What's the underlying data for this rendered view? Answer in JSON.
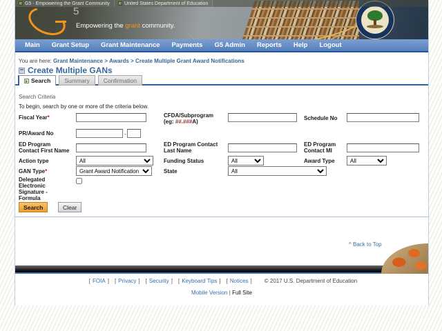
{
  "window": {
    "title_left": "G5 - Empowering the Grant Community",
    "title_right": "United States Department of Education"
  },
  "banner": {
    "logo_number": "5",
    "slogan_prefix": "Empowering the ",
    "slogan_accent": "grant",
    "slogan_suffix": " community."
  },
  "nav": {
    "items": [
      "Main",
      "Grant Setup",
      "Grant Maintenance",
      "Payments",
      "G5 Admin",
      "Reports",
      "Help",
      "Logout"
    ]
  },
  "breadcrumb": {
    "prefix": "You are here:",
    "separator": ">",
    "items": [
      "Grant Maintenance",
      "Awards",
      "Create Multiple Grant Award Notifications"
    ]
  },
  "page": {
    "title": "Create Multiple GANs"
  },
  "tabs": {
    "search": "Search",
    "summary": "Summary",
    "confirmation": "Confirmation"
  },
  "search_section": {
    "title": "Search Criteria",
    "instruction": "To begin, search by one or more of the criteria below."
  },
  "form": {
    "fiscal_year": {
      "label": "Fiscal Year",
      "required": "*"
    },
    "cfda": {
      "label": "CFDA/Subprogram",
      "hint_prefix": "(eg: ",
      "hint_pattern": "##.###",
      "hint_suffix": "A)"
    },
    "schedule_no": {
      "label": "Schedule No"
    },
    "pr_award": {
      "label": "PR/Award No",
      "separator": "-"
    },
    "ed_first": {
      "label": "ED Program Contact First Name"
    },
    "ed_last": {
      "label": "ED Program Contact Last Name"
    },
    "ed_mi": {
      "label": "ED Program Contact MI"
    },
    "action_type": {
      "label": "Action type",
      "value": "All"
    },
    "funding_status": {
      "label": "Funding Status",
      "value": "All"
    },
    "award_type": {
      "label": "Award Type",
      "value": "All"
    },
    "gan_type": {
      "label": "GAN Type",
      "required": "*",
      "value": "Grant Award Notification"
    },
    "state": {
      "label": "State",
      "value": "All"
    },
    "delegated": {
      "label": "Delegated Electronic Signature - Formula"
    }
  },
  "buttons": {
    "search": "Search",
    "clear": "Clear"
  },
  "back_to_top": "^ Back to Top",
  "footer": {
    "bracket_open": "[",
    "bracket_close": "]",
    "links": [
      "FOIA",
      "Privacy",
      "Security",
      "Keyboard Tips",
      "Notices"
    ],
    "copyright": "©  2017  U.S.  Department  of  Education",
    "mobile_version": "Mobile Version",
    "divider": "|",
    "full_site": "Full Site"
  },
  "colors": {
    "accent_orange": "#F6921E",
    "nav_blue": "#5B85C0",
    "link_blue": "#336699",
    "button_orange": "#F2A33C",
    "required_red": "#CC2200"
  }
}
